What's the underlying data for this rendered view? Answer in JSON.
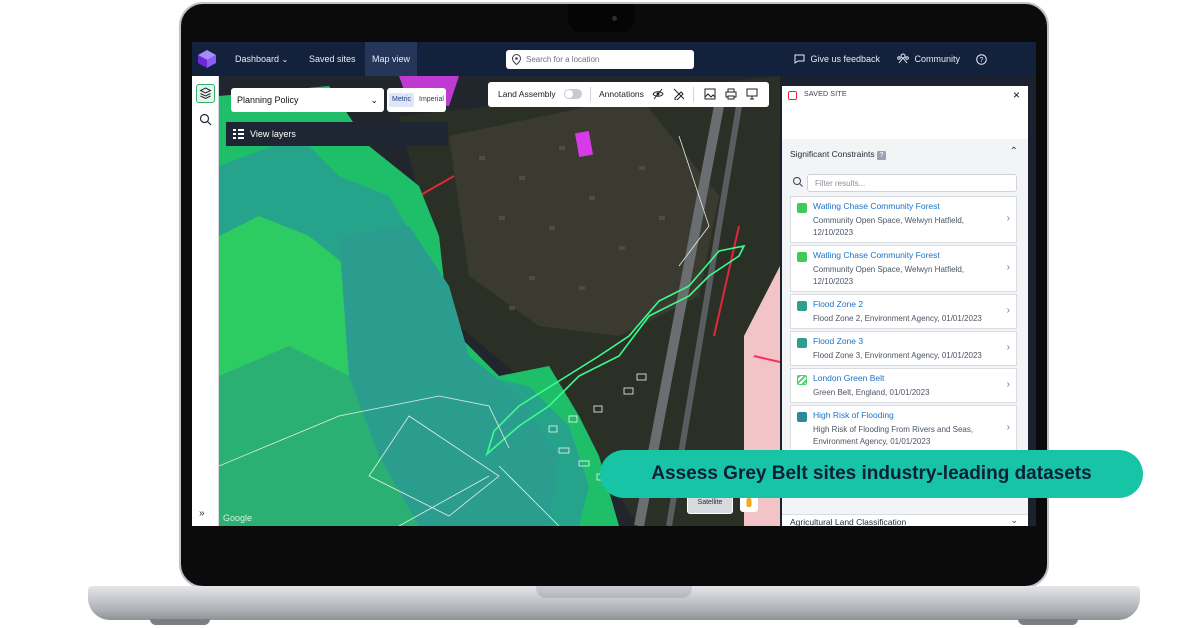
{
  "nav": {
    "dashboard": "Dashboard",
    "saved_sites": "Saved sites",
    "map_view": "Map view",
    "search_placeholder": "Search for a location",
    "feedback": "Give us feedback",
    "community": "Community"
  },
  "controls": {
    "policy_select": "Planning Policy",
    "unit_metric": "Metric",
    "unit_imperial": "Imperial",
    "view_layers": "View layers"
  },
  "toolbar": {
    "land_assembly": "Land Assembly",
    "land_assembly_on": false,
    "annotations": "Annotations"
  },
  "map": {
    "satellite_label": "Satellite",
    "google_label": "Google"
  },
  "panel": {
    "title": "SAVED SITE",
    "section_title": "Significant Constraints",
    "filter_placeholder": "Filter results...",
    "items": [
      {
        "title": "Watling Chase Community Forest",
        "desc": "Community Open Space, Welwyn Hatfield, 12/10/2023",
        "color": "#3ecb5a"
      },
      {
        "title": "Watling Chase Community Forest",
        "desc": "Community Open Space, Welwyn Hatfield, 12/10/2023",
        "color": "#3ecb5a"
      },
      {
        "title": "Flood Zone 2",
        "desc": "Flood Zone 2, Environment Agency, 01/01/2023",
        "color": "#2f9e91"
      },
      {
        "title": "Flood Zone 3",
        "desc": "Flood Zone 3, Environment Agency, 01/01/2023",
        "color": "#2f9e91"
      },
      {
        "title": "London Green Belt",
        "desc": "Green Belt, England, 01/01/2023",
        "color": "#4fd16a"
      },
      {
        "title": "High Risk of Flooding",
        "desc": "High Risk of Flooding From Rivers and Seas, Environment Agency, 01/01/2023",
        "color": "#2b8a9a"
      }
    ],
    "next_section": "Agricultural Land Classification"
  },
  "badge": "Assess Grey Belt sites industry-leading datasets",
  "colors": {
    "topbar": "#14213d",
    "accent": "#18c4a6",
    "link": "#1b72c8"
  }
}
